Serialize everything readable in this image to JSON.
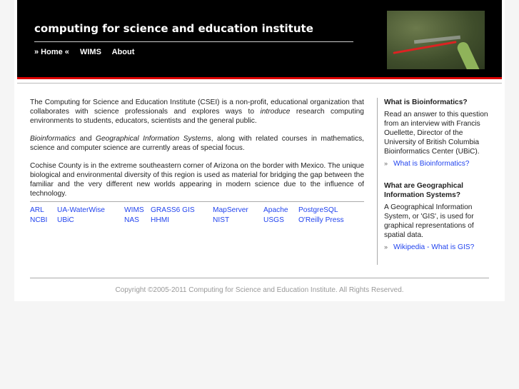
{
  "header": {
    "title": "computing for science and education institute",
    "nav": [
      "» Home «",
      "WIMS",
      "About"
    ],
    "image_icon": "dragonfly-photo"
  },
  "main": {
    "p1": {
      "a": "The Computing for Science and Education Institute (CSEI) is a non-profit, educational organization that collaborates with science professionals and explores ways to ",
      "em": "introduce",
      "b": " research computing environments to students, educators, scientists and the general public."
    },
    "p2": {
      "em1": "Bioinformatics",
      "a": " and ",
      "em2": "Geographical Information Systems",
      "b": ", along with related courses in mathematics, science and computer science are currently areas of special focus."
    },
    "p3": "Cochise County is in the extreme southeastern corner of Arizona on the border with Mexico. The unique biological and environmental diversity of this region is used as material for bridging the gap between the familiar and the very different new worlds appearing in modern science due to the influence of technology.",
    "links": [
      "ARL",
      "UA-WaterWise",
      "WIMS",
      "GRASS6 GIS",
      "MapServer",
      "Apache",
      "PostgreSQL",
      "NCBI",
      "UBiC",
      "NAS",
      "HHMI",
      "NIST",
      "USGS",
      "O'Reilly Press"
    ]
  },
  "sidebar": {
    "s1": {
      "heading": "What is Bioinformatics?",
      "text": "Read an answer to this question from an interview with Francis Ouellette, Director of the University of British Columbia Bioinformatics Center (UBiC).",
      "bullet": "»",
      "link": "What is Bioinformatics?"
    },
    "s2": {
      "heading": "What are Geographical Information Systems?",
      "text": "A Geographical Information System, or 'GIS', is used for graphical representations of spatial data.",
      "bullet": "»",
      "link": "Wikipedia - What is GIS?"
    }
  },
  "colors": {
    "accent": "#dd0000",
    "link": "#2244ee"
  },
  "footer": "Copyright ©2005-2011 Computing for Science and Education Institute. All Rights Reserved."
}
